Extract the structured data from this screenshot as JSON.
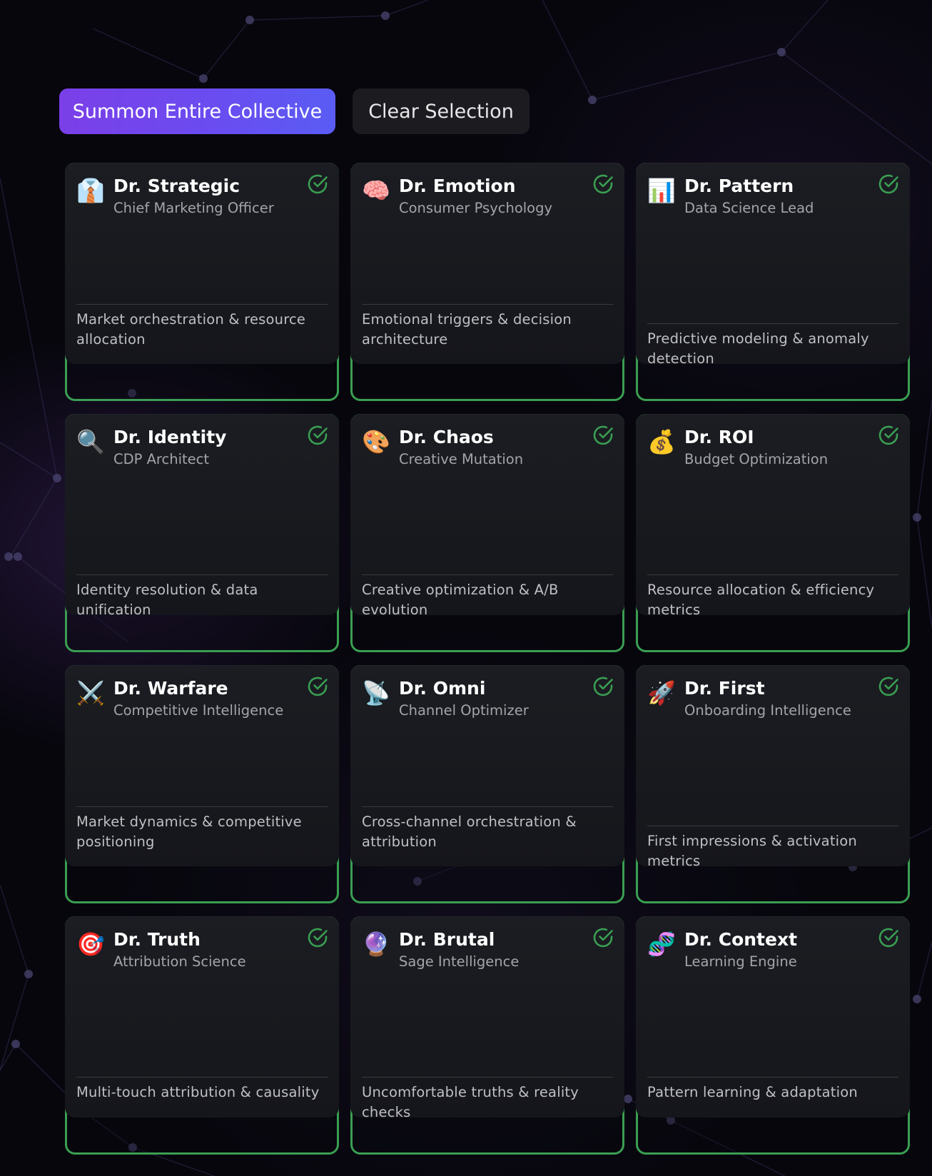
{
  "actions": {
    "summon_label": "Summon Entire Collective",
    "clear_label": "Clear Selection"
  },
  "accent_color": "#3a9e52",
  "agents": [
    {
      "icon": "necktie-icon",
      "glyph": "👔",
      "name": "Dr. Strategic",
      "role": "Chief Marketing Officer",
      "description": "Market orchestration & resource allocation",
      "selected": true
    },
    {
      "icon": "brain-icon",
      "glyph": "🧠",
      "name": "Dr. Emotion",
      "role": "Consumer Psychology",
      "description": "Emotional triggers & decision architecture",
      "selected": true
    },
    {
      "icon": "bar-chart-icon",
      "glyph": "📊",
      "name": "Dr. Pattern",
      "role": "Data Science Lead",
      "description": "Predictive modeling & anomaly detection",
      "selected": true
    },
    {
      "icon": "magnifying-glass-icon",
      "glyph": "🔍",
      "name": "Dr. Identity",
      "role": "CDP Architect",
      "description": "Identity resolution & data unification",
      "selected": true
    },
    {
      "icon": "palette-icon",
      "glyph": "🎨",
      "name": "Dr. Chaos",
      "role": "Creative Mutation",
      "description": "Creative optimization & A/B evolution",
      "selected": true
    },
    {
      "icon": "money-bag-icon",
      "glyph": "💰",
      "name": "Dr. ROI",
      "role": "Budget Optimization",
      "description": "Resource allocation & efficiency metrics",
      "selected": true
    },
    {
      "icon": "crossed-swords-icon",
      "glyph": "⚔️",
      "name": "Dr. Warfare",
      "role": "Competitive Intelligence",
      "description": "Market dynamics & competitive positioning",
      "selected": true
    },
    {
      "icon": "satellite-dish-icon",
      "glyph": "📡",
      "name": "Dr. Omni",
      "role": "Channel Optimizer",
      "description": "Cross-channel orchestration & attribution",
      "selected": true
    },
    {
      "icon": "rocket-icon",
      "glyph": "🚀",
      "name": "Dr. First",
      "role": "Onboarding Intelligence",
      "description": "First impressions & activation metrics",
      "selected": true
    },
    {
      "icon": "target-icon",
      "glyph": "🎯",
      "name": "Dr. Truth",
      "role": "Attribution Science",
      "description": "Multi-touch attribution & causality",
      "selected": true
    },
    {
      "icon": "crystal-ball-icon",
      "glyph": "🔮",
      "name": "Dr. Brutal",
      "role": "Sage Intelligence",
      "description": "Uncomfortable truths & reality checks",
      "selected": true
    },
    {
      "icon": "dna-icon",
      "glyph": "🧬",
      "name": "Dr. Context",
      "role": "Learning Engine",
      "description": "Pattern learning & adaptation",
      "selected": true
    }
  ]
}
